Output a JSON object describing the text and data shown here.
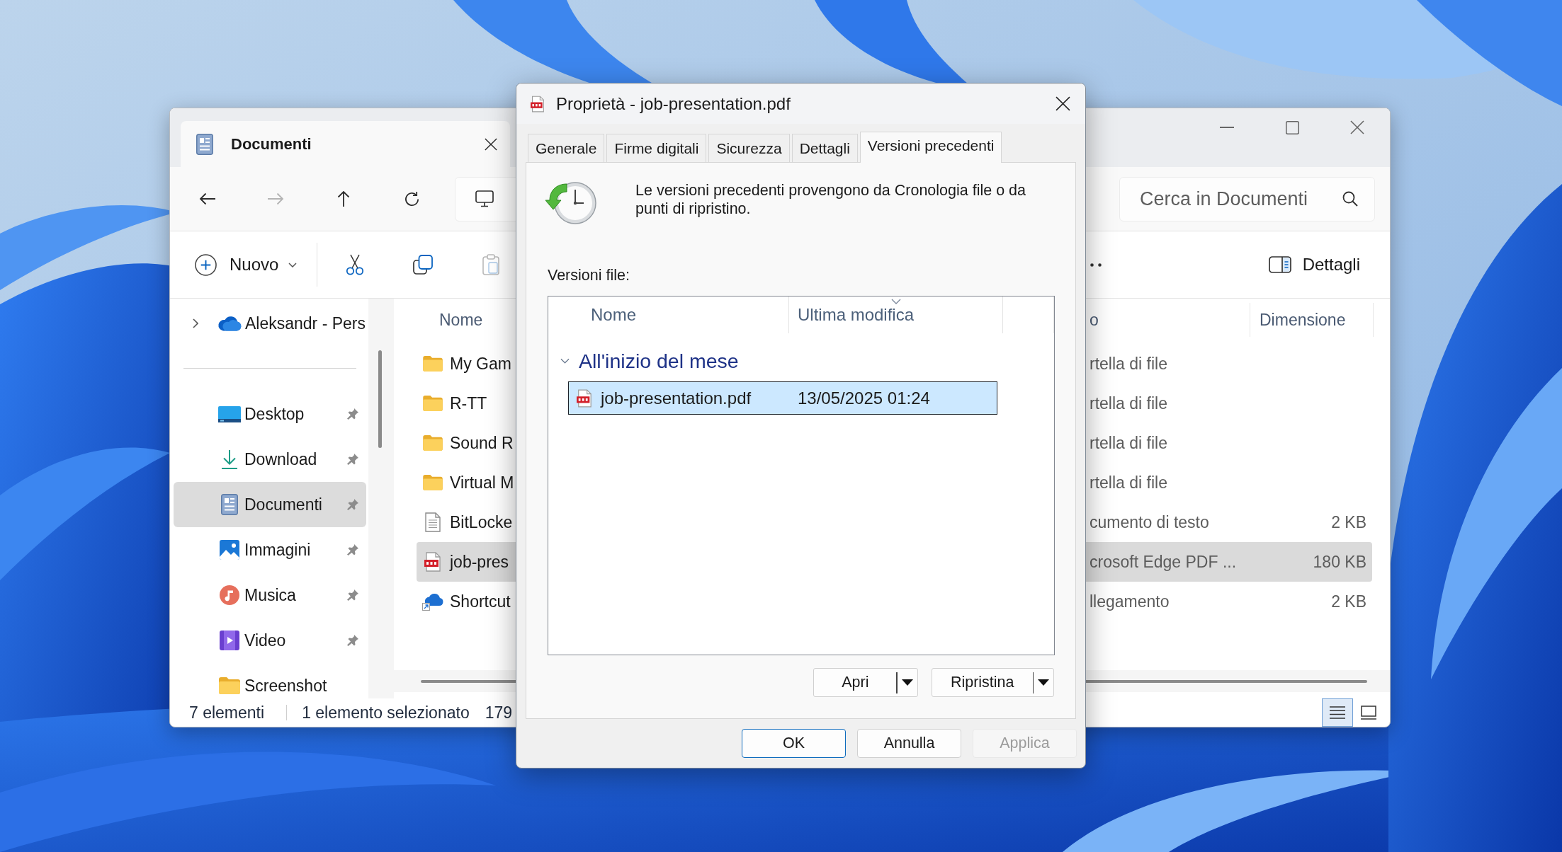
{
  "explorer": {
    "tab": {
      "title": "Documenti"
    },
    "nav_buttons": [
      {
        "kind": "back",
        "disabled": false
      },
      {
        "kind": "forward",
        "disabled": true
      },
      {
        "kind": "up",
        "disabled": false
      },
      {
        "kind": "refresh",
        "disabled": false
      }
    ],
    "search": {
      "placeholder": "Cerca in Documenti"
    },
    "new_button": {
      "label": "Nuovo"
    },
    "command_buttons": [
      {
        "kind": "cut",
        "disabled": false
      },
      {
        "kind": "copy",
        "disabled": false
      },
      {
        "kind": "paste",
        "disabled": true
      }
    ],
    "details_button": {
      "label": "Dettagli"
    },
    "sidebar": {
      "cloud_root": {
        "label": "Aleksandr - Pers",
        "expanded": false
      },
      "items": [
        {
          "kind": "desktop",
          "label": "Desktop",
          "pinned": true,
          "selected": false
        },
        {
          "kind": "download",
          "label": "Download",
          "pinned": true,
          "selected": false
        },
        {
          "kind": "documents",
          "label": "Documenti",
          "pinned": true,
          "selected": true
        },
        {
          "kind": "pictures",
          "label": "Immagini",
          "pinned": true,
          "selected": false
        },
        {
          "kind": "music",
          "label": "Musica",
          "pinned": true,
          "selected": false
        },
        {
          "kind": "video",
          "label": "Video",
          "pinned": true,
          "selected": false
        },
        {
          "kind": "folder",
          "label": "Screenshot",
          "pinned": false,
          "selected": false
        }
      ]
    },
    "file_list": {
      "columns": [
        {
          "label": "Nome"
        },
        {
          "label": "o"
        },
        {
          "label": "Dimensione"
        }
      ],
      "rows": [
        {
          "kind": "folder",
          "name": "My Gam",
          "type": "rtella di file",
          "selected": false
        },
        {
          "kind": "folder",
          "name": "R-TT",
          "type": "rtella di file",
          "selected": false
        },
        {
          "kind": "folder",
          "name": "Sound R",
          "type": "rtella di file",
          "selected": false
        },
        {
          "kind": "folder",
          "name": "Virtual M",
          "type": "rtella di file",
          "selected": false
        },
        {
          "kind": "text",
          "name": "BitLocke",
          "type": "cumento di testo",
          "size": "2 KB",
          "selected": false
        },
        {
          "kind": "pdf",
          "name": "job-pres",
          "type": "crosoft Edge PDF ...",
          "size": "180 KB",
          "selected": true
        },
        {
          "kind": "shortcut",
          "name": "Shortcut",
          "type": "llegamento",
          "size": "2 KB",
          "selected": false
        }
      ]
    },
    "status_bar": {
      "count": "7 elementi",
      "selection": "1 elemento selezionato",
      "size": "179"
    },
    "view_buttons": [
      {
        "kind": "details",
        "selected": true
      },
      {
        "kind": "tiles",
        "selected": false
      }
    ]
  },
  "dialog": {
    "title": "Proprietà - job-presentation.pdf",
    "tabs": [
      {
        "label": "Generale",
        "selected": false
      },
      {
        "label": "Firme digitali",
        "selected": false
      },
      {
        "label": "Sicurezza",
        "selected": false
      },
      {
        "label": "Dettagli",
        "selected": false
      },
      {
        "label": "Versioni precedenti",
        "selected": true
      }
    ],
    "info": "Le versioni precedenti provengono da Cronologia file o da punti di ripristino.",
    "list_label": "Versioni file:",
    "columns": [
      {
        "label": "Nome",
        "sorted": false
      },
      {
        "label": "Ultima modifica",
        "sorted": true
      }
    ],
    "groups": [
      {
        "label": "All'inizio del mese",
        "expanded": true,
        "items": [
          {
            "name": "job-presentation.pdf",
            "modified": "13/05/2025 01:24",
            "selected": true
          }
        ]
      }
    ],
    "actions": [
      {
        "label": "Apri"
      },
      {
        "label": "Ripristina"
      }
    ],
    "buttons": [
      {
        "label": "OK",
        "default": true,
        "disabled": false
      },
      {
        "label": "Annulla",
        "default": false,
        "disabled": false
      },
      {
        "label": "Applica",
        "default": false,
        "disabled": true
      }
    ]
  }
}
